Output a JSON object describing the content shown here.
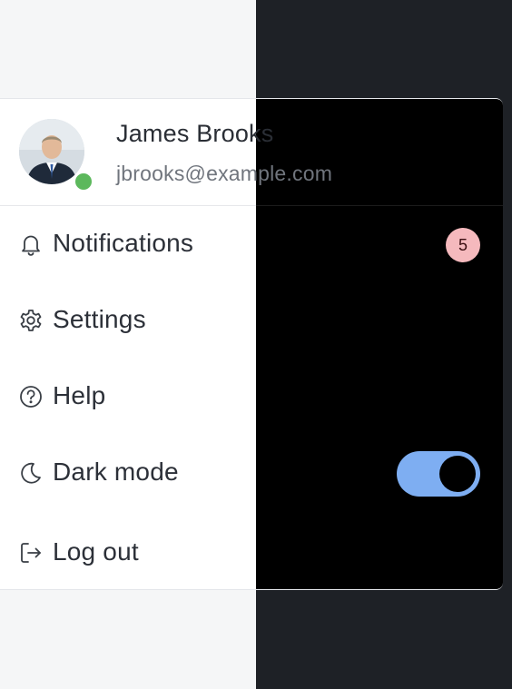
{
  "profile": {
    "name": "James Brooks",
    "email": "jbrooks@example.com",
    "status": "online"
  },
  "menu": {
    "items": [
      {
        "label": "Notifications",
        "icon": "bell-icon",
        "badge": "5"
      },
      {
        "label": "Settings",
        "icon": "gear-icon"
      },
      {
        "label": "Help",
        "icon": "help-circle-icon"
      },
      {
        "label": "Dark mode",
        "icon": "moon-icon",
        "toggle_on": true
      }
    ],
    "logout_label": "Log out",
    "logout_icon": "logout-icon"
  },
  "colors": {
    "status_online": "#5cb85c",
    "badge_bg": "#f5b9bd",
    "toggle_bg": "#7eaef2"
  }
}
